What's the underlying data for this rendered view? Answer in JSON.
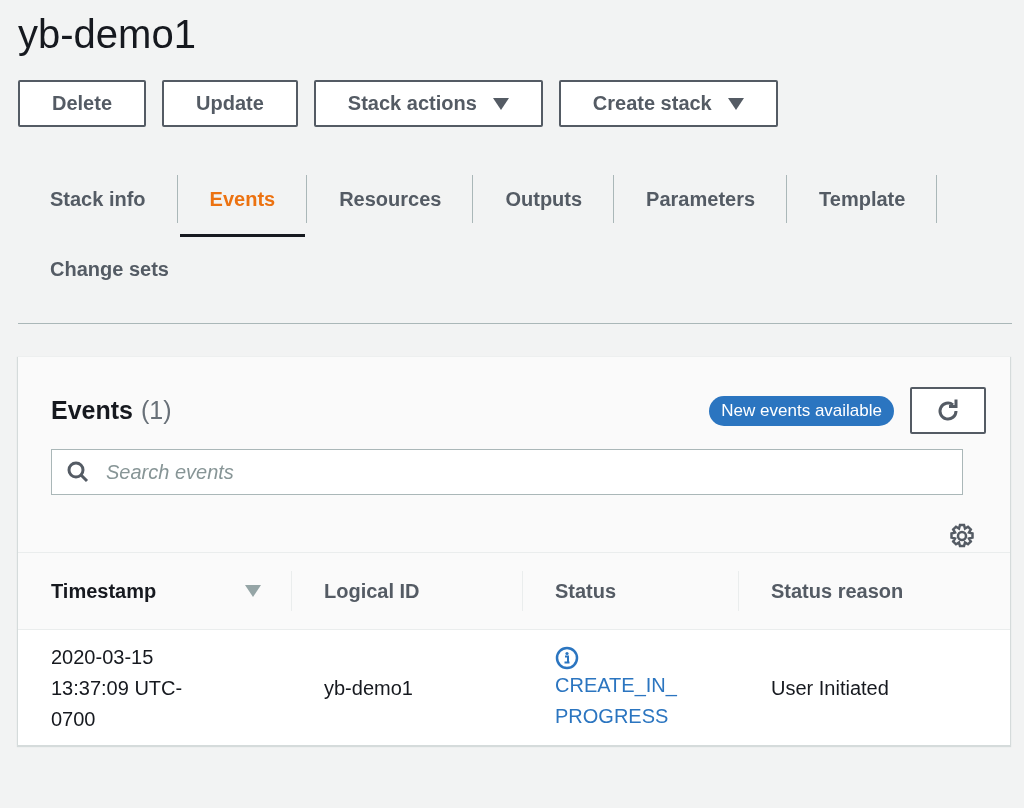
{
  "title": "yb-demo1",
  "buttons": [
    {
      "label": "Delete",
      "dropdown": false
    },
    {
      "label": "Update",
      "dropdown": false
    },
    {
      "label": "Stack actions",
      "dropdown": true
    },
    {
      "label": "Create stack",
      "dropdown": true
    }
  ],
  "tabs": [
    {
      "label": "Stack info",
      "selected": false
    },
    {
      "label": "Events",
      "selected": true
    },
    {
      "label": "Resources",
      "selected": false
    },
    {
      "label": "Outputs",
      "selected": false
    },
    {
      "label": "Parameters",
      "selected": false
    },
    {
      "label": "Template",
      "selected": false
    },
    {
      "label": "Change sets",
      "selected": false
    }
  ],
  "events_panel": {
    "title": "Events",
    "count": "(1)",
    "badge": "New events available",
    "search": {
      "placeholder": "Search events"
    },
    "table": {
      "columns": [
        {
          "label": "Timestamp",
          "sorted": true
        },
        {
          "label": "Logical ID",
          "sorted": false
        },
        {
          "label": "Status",
          "sorted": false
        },
        {
          "label": "Status reason",
          "sorted": false
        }
      ],
      "rows": [
        {
          "timestamp": "2020-03-15 13:37:09 UTC-0700",
          "logical_id": "yb-demo1",
          "status": "CREATE_IN_PROGRESS",
          "status_reason": "User Initiated"
        }
      ]
    }
  }
}
